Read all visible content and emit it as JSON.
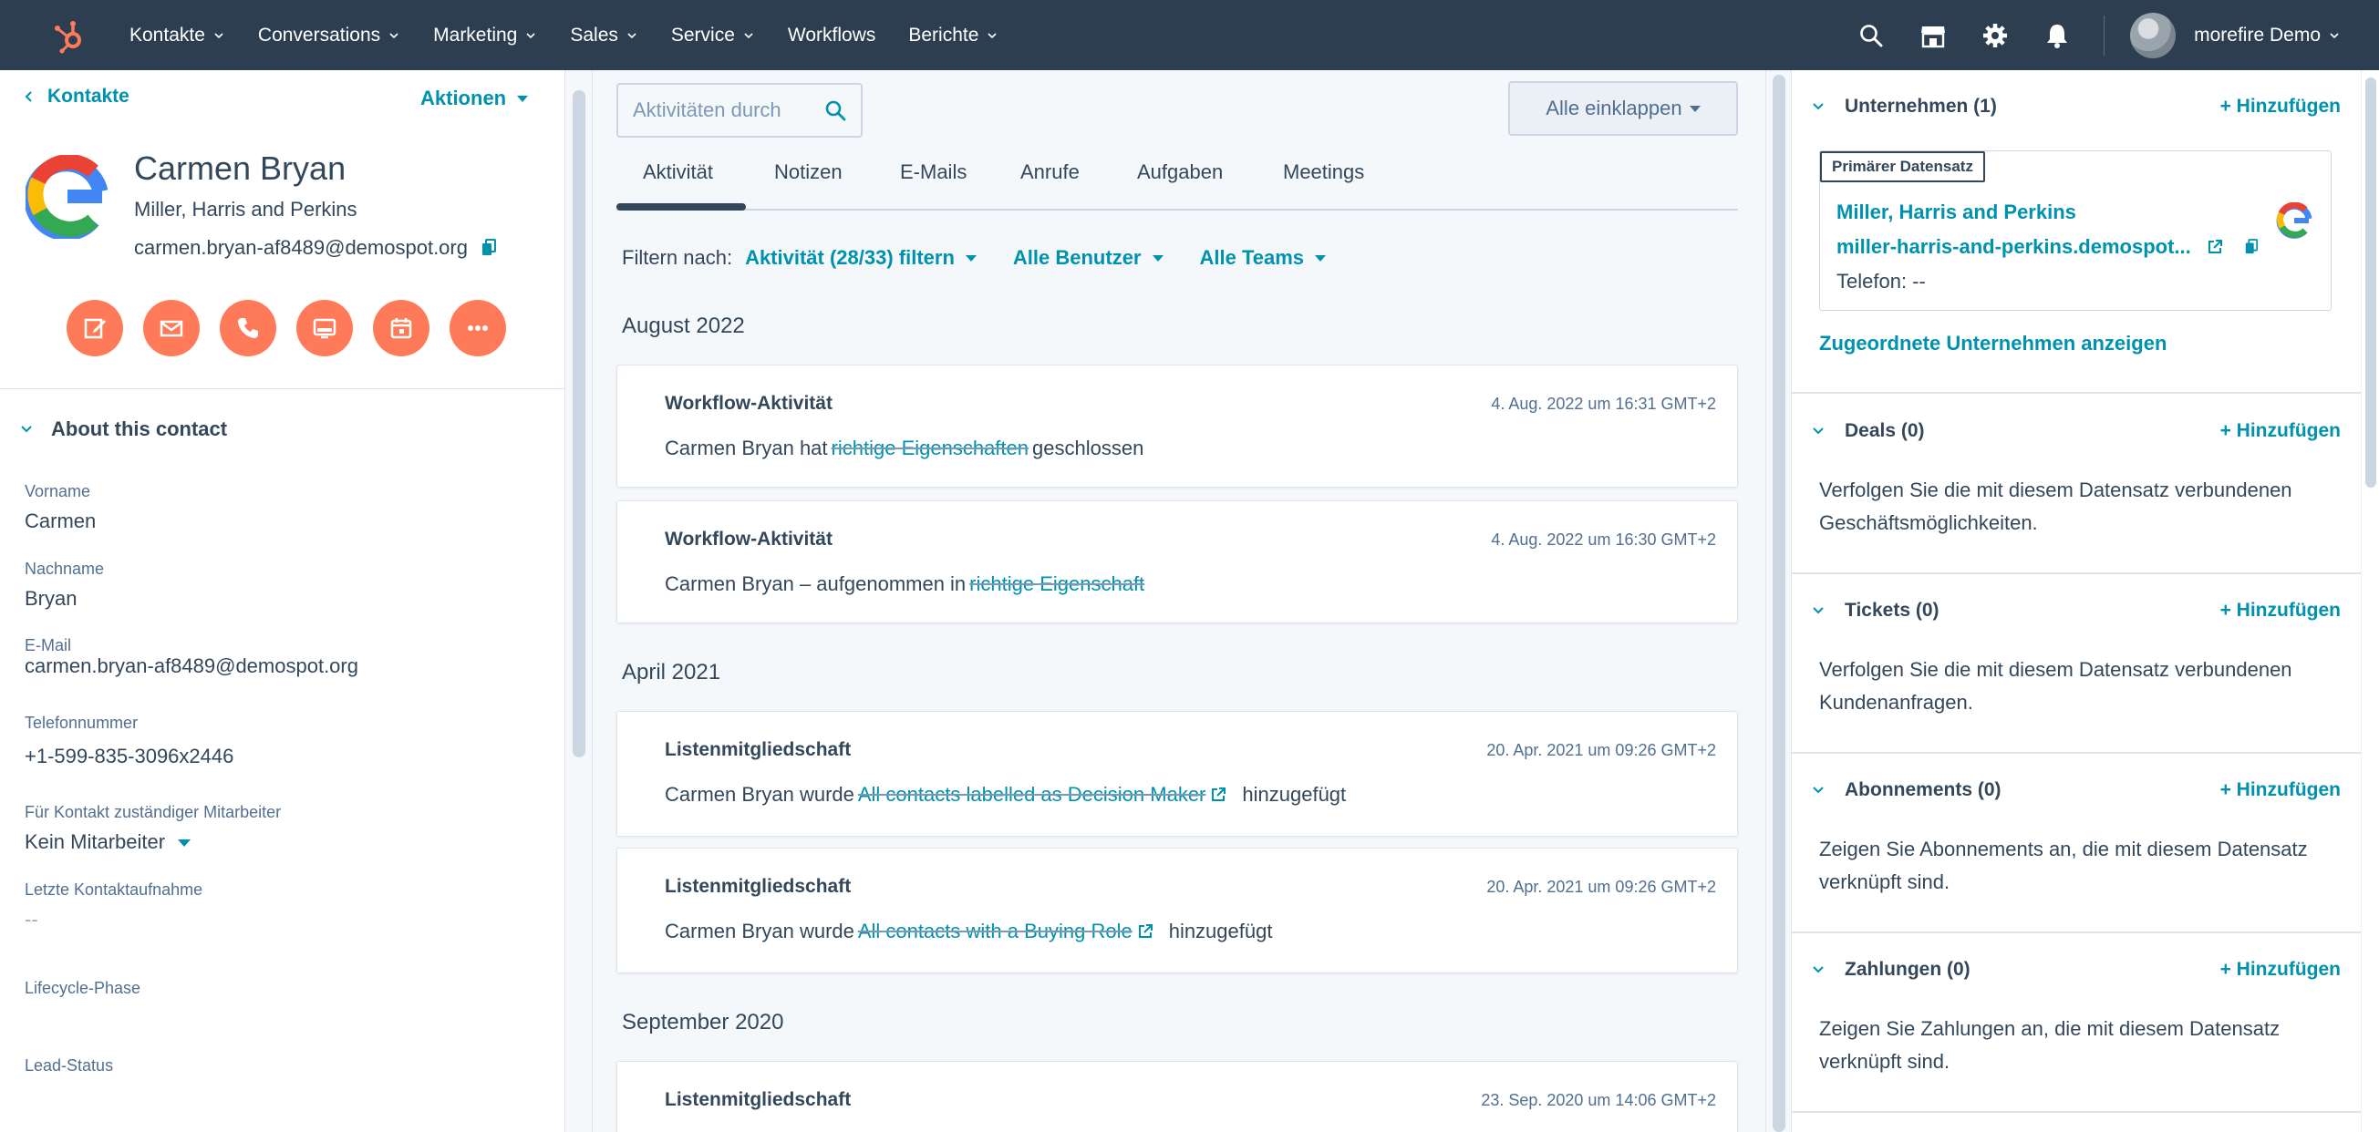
{
  "nav": {
    "items": [
      "Kontakte",
      "Conversations",
      "Marketing",
      "Sales",
      "Service",
      "Workflows",
      "Berichte"
    ],
    "account_name": "morefire Demo"
  },
  "left": {
    "back_label": "Kontakte",
    "actions_label": "Aktionen",
    "contact": {
      "name": "Carmen Bryan",
      "company": "Miller, Harris and Perkins",
      "email": "carmen.bryan-af8489@demospot.org"
    },
    "about_title": "About this contact",
    "properties": [
      {
        "label": "Vorname",
        "value": "Carmen"
      },
      {
        "label": "Nachname",
        "value": "Bryan"
      },
      {
        "label": "E-Mail",
        "value": "carmen.bryan-af8489@demospot.org"
      },
      {
        "label": "Telefonnummer",
        "value": "+1-599-835-3096x2446"
      },
      {
        "label": "Für Kontakt zuständiger Mitarbeiter",
        "value": "Kein Mitarbeiter"
      },
      {
        "label": "Letzte Kontaktaufnahme",
        "value": "--"
      },
      {
        "label": "Lifecycle-Phase",
        "value": ""
      },
      {
        "label": "Lead-Status",
        "value": ""
      }
    ]
  },
  "mid": {
    "search_placeholder": "Aktivitäten durch",
    "collapse_label": "Alle einklappen",
    "tabs": [
      "Aktivität",
      "Notizen",
      "E-Mails",
      "Anrufe",
      "Aufgaben",
      "Meetings"
    ],
    "filter_label": "Filtern nach:",
    "filters": [
      "Aktivität (28/33) filtern",
      "Alle Benutzer",
      "Alle Teams"
    ],
    "months": [
      "August 2022",
      "April 2021",
      "September 2020"
    ],
    "cards": [
      {
        "title": "Workflow-Aktivität",
        "time": "4. Aug. 2022 um 16:31 GMT+2",
        "prefix": "Carmen Bryan hat",
        "link": "richtige Eigenschaften",
        "suffix": "geschlossen"
      },
      {
        "title": "Workflow-Aktivität",
        "time": "4. Aug. 2022 um 16:30 GMT+2",
        "prefix": "Carmen Bryan – aufgenommen in",
        "link": "richtige Eigenschaft",
        "suffix": ""
      },
      {
        "title": "Listenmitgliedschaft",
        "time": "20. Apr. 2021 um 09:26 GMT+2",
        "prefix": "Carmen Bryan wurde",
        "link": "All contacts labelled as Decision Maker",
        "suffix": "hinzugefügt"
      },
      {
        "title": "Listenmitgliedschaft",
        "time": "20. Apr. 2021 um 09:26 GMT+2",
        "prefix": "Carmen Bryan wurde",
        "link": "All contacts with a Buying Role",
        "suffix": "hinzugefügt"
      },
      {
        "title": "Listenmitgliedschaft",
        "time": "23. Sep. 2020 um 14:06 GMT+2",
        "prefix": "",
        "link": "",
        "suffix": ""
      }
    ]
  },
  "right": {
    "add_label": "+ Hinzufügen",
    "company_section": {
      "title": "Unternehmen (1)",
      "badge": "Primärer Datensatz",
      "company_name": "Miller, Harris and Perkins",
      "company_domain": "miller-harris-and-perkins.demospot...",
      "phone": "Telefon: --",
      "show_assoc": "Zugeordnete Unternehmen anzeigen"
    },
    "sections": [
      {
        "title": "Deals (0)",
        "text": "Verfolgen Sie die mit diesem Datensatz verbundenen Geschäftsmöglichkeiten."
      },
      {
        "title": "Tickets (0)",
        "text": "Verfolgen Sie die mit diesem Datensatz verbundenen Kundenanfragen."
      },
      {
        "title": "Abonnements (0)",
        "text": "Zeigen Sie Abonnements an, die mit diesem Datensatz verknüpft sind."
      },
      {
        "title": "Zahlungen (0)",
        "text": "Zeigen Sie Zahlungen an, die mit diesem Datensatz verknüpft sind."
      }
    ]
  },
  "colors": {
    "nav_bg": "#2d3e50",
    "accent_link": "#0091ae",
    "hubspot_orange": "#ff7a59",
    "text": "#33475b"
  },
  "icons": [
    "hubspot-logo-icon",
    "search-icon",
    "marketplace-icon",
    "gear-icon",
    "bell-icon",
    "note-icon",
    "email-icon",
    "phone-icon",
    "screen-icon",
    "calendar-icon",
    "more-icon",
    "copy-icon",
    "external-link-icon",
    "google-logo-icon"
  ]
}
